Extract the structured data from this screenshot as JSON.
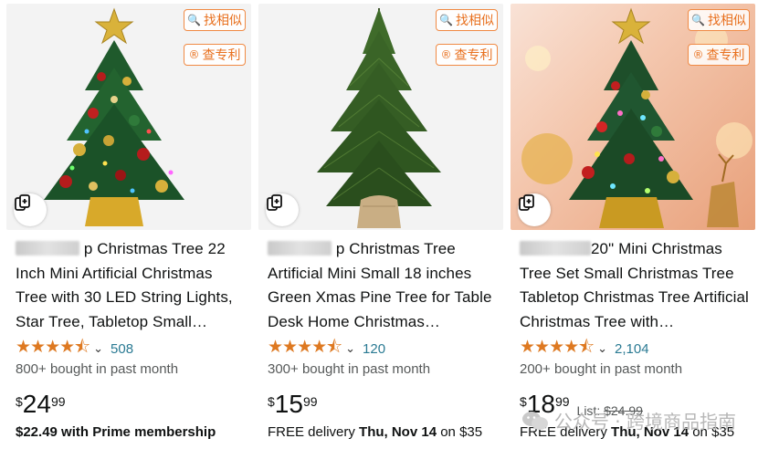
{
  "tools": {
    "find_similar": "找相似",
    "check_patent": "查专利"
  },
  "watermark": "公众号 · 跨境商品指南",
  "products": [
    {
      "title_visible": "p Christmas Tree 22 Inch Mini Artificial Christmas Tree with 30 LED String Lights, Star Tree, Tabletop Small…",
      "rating_stars": 4.5,
      "rating_count": "508",
      "bought": "800+ bought in past month",
      "price_symbol": "$",
      "price_whole": "24",
      "price_fraction": "99",
      "list_label": "",
      "list_price": "",
      "extra_bold": "$22.49 with Prime membership",
      "extra_prefix": "",
      "extra_suffix": ""
    },
    {
      "title_visible": "p Christmas Tree Artificial Mini Small 18 inches Green Xmas Pine Tree for Table Desk Home Christmas…",
      "rating_stars": 4.5,
      "rating_count": "120",
      "bought": "300+ bought in past month",
      "price_symbol": "$",
      "price_whole": "15",
      "price_fraction": "99",
      "list_label": "",
      "list_price": "",
      "extra_bold": "Thu, Nov 14",
      "extra_prefix": "FREE delivery ",
      "extra_suffix": " on $35"
    },
    {
      "title_visible": "20\" Mini Christmas Tree Set Small Christmas Tree Tabletop Christmas Tree Artificial Christmas Tree with…",
      "rating_stars": 4.5,
      "rating_count": "2,104",
      "bought": "200+ bought in past month",
      "price_symbol": "$",
      "price_whole": "18",
      "price_fraction": "99",
      "list_label": "List: ",
      "list_price": "$24.99",
      "extra_bold": "Thu, Nov 14",
      "extra_prefix": "FREE delivery ",
      "extra_suffix": " on $35"
    }
  ]
}
